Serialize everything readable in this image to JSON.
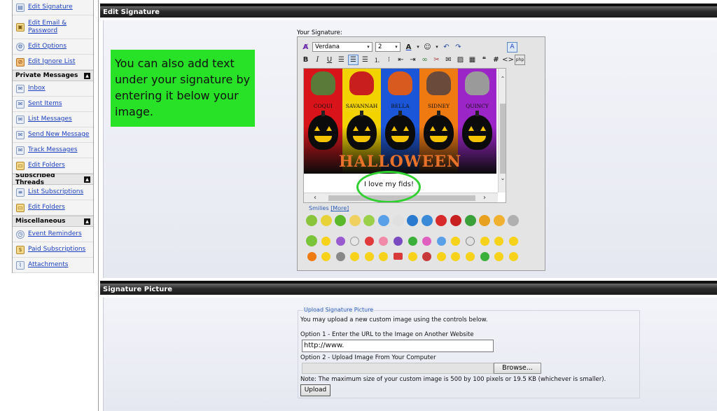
{
  "sidebar": {
    "top_items": [
      {
        "label": "Edit Signature",
        "icon": "document-icon"
      },
      {
        "label": "Edit Email & Password",
        "icon": "lock-icon"
      },
      {
        "label": "Edit Options",
        "icon": "gear-icon"
      },
      {
        "label": "Edit Ignore List",
        "icon": "ignore-icon"
      }
    ],
    "sections": [
      {
        "title": "Private Messages",
        "items": [
          {
            "label": "Inbox",
            "icon": "inbox-icon"
          },
          {
            "label": "Sent Items",
            "icon": "sent-icon"
          },
          {
            "label": "List Messages",
            "icon": "list-icon"
          },
          {
            "label": "Send New Message",
            "icon": "new-message-icon"
          },
          {
            "label": "Track Messages",
            "icon": "track-icon"
          },
          {
            "label": "Edit Folders",
            "icon": "folder-icon"
          }
        ]
      },
      {
        "title": "Subscribed Threads",
        "items": [
          {
            "label": "List Subscriptions",
            "icon": "list-icon"
          },
          {
            "label": "Edit Folders",
            "icon": "folder-icon"
          }
        ]
      },
      {
        "title": "Miscellaneous",
        "items": [
          {
            "label": "Event Reminders",
            "icon": "clock-icon"
          },
          {
            "label": "Paid Subscriptions",
            "icon": "subscription-icon"
          },
          {
            "label": "Attachments",
            "icon": "paperclip-icon"
          }
        ]
      }
    ]
  },
  "edit_signature": {
    "panel_title": "Edit Signature",
    "callout_text": "You can also add text under your signature by entering it below your image.",
    "your_signature_label": "Your Signature:",
    "toolbar": {
      "font": "Verdana",
      "size": "2"
    },
    "banner": {
      "names": [
        "COQUI",
        "SAVANNAH",
        "BELLA",
        "SIDNEY",
        "QUINCY"
      ],
      "title": "HALLOWEEN",
      "column_colors": [
        "#d8141a",
        "#f2d300",
        "#1b56d8",
        "#f07a12",
        "#9c25c8"
      ]
    },
    "signature_text": "I love my fids!",
    "smilies_label": "Smilies",
    "smilies_more": "[More]"
  },
  "signature_picture": {
    "panel_title": "Signature Picture",
    "legend": "Upload Signature Picture",
    "intro": "You may upload a new custom image using the controls below.",
    "option1_label": "Option 1 - Enter the URL to the Image on Another Website",
    "url_value": "http://www.",
    "option2_label": "Option 2 - Upload Image From Your Computer",
    "browse_label": "Browse...",
    "note": "Note: The maximum size of your custom image is 500 by 100 pixels or 19.5 KB (whichever is smaller).",
    "upload_label": "Upload"
  },
  "colors": {
    "callout_bg": "#27e226",
    "highlight_circle": "#2fd02f",
    "panel_header": "#1c1c1c",
    "link": "#1a3fbf"
  }
}
